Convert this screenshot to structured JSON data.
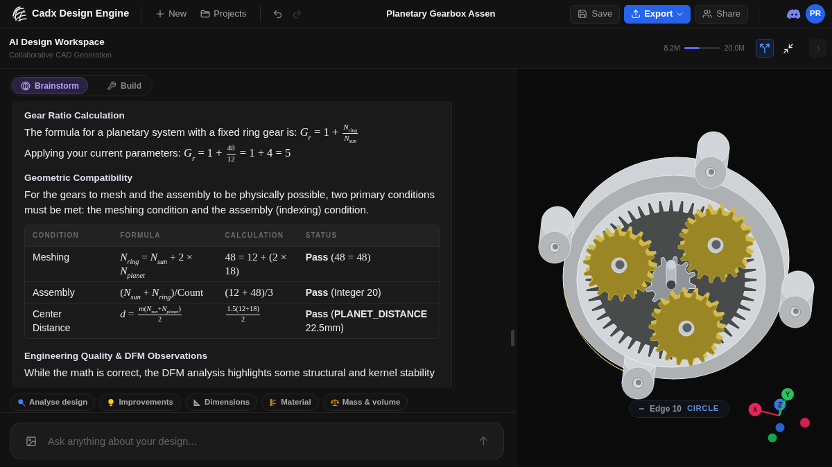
{
  "app": {
    "brand": "Cadx Design Engine",
    "nav": [
      {
        "label": "New",
        "kind": "plus"
      },
      {
        "label": "Projects",
        "kind": "folder"
      }
    ],
    "history": [
      {
        "kind": "undo",
        "disabled": false
      },
      {
        "kind": "redo",
        "disabled": true
      }
    ],
    "document_title": "Planetary Gearbox Assen",
    "actions": [
      {
        "label": "Save",
        "kind": "save"
      },
      {
        "label": "Export",
        "kind": "export"
      },
      {
        "label": "Share",
        "kind": "share"
      }
    ],
    "avatar": {
      "initials": "PR"
    }
  },
  "workspace": {
    "title": "AI Design Workspace",
    "subtitle": "Collaborative CAD Generation",
    "memory": {
      "used": "8.2M",
      "total": "20.0M",
      "level": 0.42
    },
    "view_toggles": [
      {
        "kind": "branch",
        "on": true
      },
      {
        "kind": "collapse",
        "on": false
      }
    ]
  },
  "mode_tabs": [
    {
      "label": "Brainstorm",
      "kind": "brain",
      "selected": true
    },
    {
      "label": "Build",
      "kind": "wrench",
      "selected": false
    }
  ],
  "message": {
    "blocks": [
      {
        "kind": "heading",
        "text": "Gear Ratio Calculation"
      },
      {
        "kind": "paragraph",
        "parts": [
          {
            "kind": "text",
            "text": "The formula for a planetary system with a fixed ring gear is: "
          },
          {
            "kind": "math",
            "text": "*G*$_{r}$ = 1 + "
          },
          {
            "kind": "frac",
            "num": "*N*$_{ring}$",
            "den": "*N*$_{sun}$"
          }
        ]
      },
      {
        "kind": "paragraph",
        "parts": [
          {
            "kind": "text",
            "text": "Applying your current parameters: "
          },
          {
            "kind": "math",
            "text": "*G*$_{r}$ = 1 + "
          },
          {
            "kind": "frac",
            "num": "48",
            "den": "12"
          },
          {
            "kind": "math",
            "text": " = 1 + 4 = 5"
          }
        ]
      },
      {
        "kind": "heading",
        "text": "Geometric Compatibility"
      },
      {
        "kind": "paragraph",
        "parts": [
          {
            "kind": "text",
            "text": "For the gears to mesh and the assembly to be physically possible, two primary conditions must be met: the meshing condition and the assembly (indexing) condition."
          }
        ]
      },
      {
        "kind": "table",
        "columns": [
          "CONDITION",
          "FORMULA",
          "CALCULATION",
          "STATUS"
        ],
        "rows": [
          [
            [
              {
                "kind": "text",
                "text": "Meshing"
              }
            ],
            [
              {
                "kind": "math",
                "text": "*N*$_{ring}$ = *N*$_{sun}$ + 2 × *N*$_{planet}$"
              }
            ],
            [
              {
                "kind": "math",
                "text": "48 = 12 + (2 × 18)"
              }
            ],
            [
              {
                "kind": "text",
                "text": "**Pass** "
              },
              {
                "kind": "math",
                "text": "(48 = 48)"
              }
            ]
          ],
          [
            [
              {
                "kind": "text",
                "text": "Assembly"
              }
            ],
            [
              {
                "kind": "math",
                "text": "(*N*$_{sun}$ + *N*$_{ring}$)/Count"
              }
            ],
            [
              {
                "kind": "math",
                "text": "(12 + 48)/3"
              }
            ],
            [
              {
                "kind": "text",
                "text": "**Pass** (Integer 20)"
              }
            ]
          ],
          [
            [
              {
                "kind": "text",
                "text": "Center Distance"
              }
            ],
            [
              {
                "kind": "math",
                "text": "*d* = "
              },
              {
                "kind": "frac",
                "num": "*m*(*N*$_{sun}$+*N*$_{planet}$)",
                "den": "2"
              }
            ],
            [
              {
                "kind": "frac",
                "num": "1.5(12+18)",
                "den": "2"
              }
            ],
            [
              {
                "kind": "text",
                "text": "**Pass** (**PLANET_DISTANCE** 22.5mm)"
              }
            ]
          ]
        ]
      },
      {
        "kind": "heading",
        "text": "Engineering Quality & DFM Observations"
      },
      {
        "kind": "paragraph",
        "parts": [
          {
            "kind": "text",
            "text": "While the math is correct, the DFM analysis highlights some structural and kernel stability"
          }
        ]
      }
    ]
  },
  "suggestions": [
    {
      "label": "Analyse design",
      "kind": "search"
    },
    {
      "label": "Improvements",
      "kind": "bulb"
    },
    {
      "label": "Dimensions",
      "kind": "triangle"
    },
    {
      "label": "Material",
      "kind": "material"
    },
    {
      "label": "Mass & volume",
      "kind": "scales"
    }
  ],
  "composer": {
    "placeholder": "Ask anything about your design..."
  },
  "viewer": {
    "selection": {
      "label": "Edge 10",
      "type": "CIRCLE"
    },
    "axis_gizmo": {
      "axes": [
        {
          "label": "X",
          "color": "#e8245a"
        },
        {
          "label": "Y",
          "color": "#22c55e"
        },
        {
          "label": "Z",
          "color": "#2f7de1"
        }
      ],
      "negative": [
        {
          "color": "#d61f4f"
        },
        {
          "color": "#2563c9"
        },
        {
          "color": "#16a34a"
        }
      ]
    }
  }
}
